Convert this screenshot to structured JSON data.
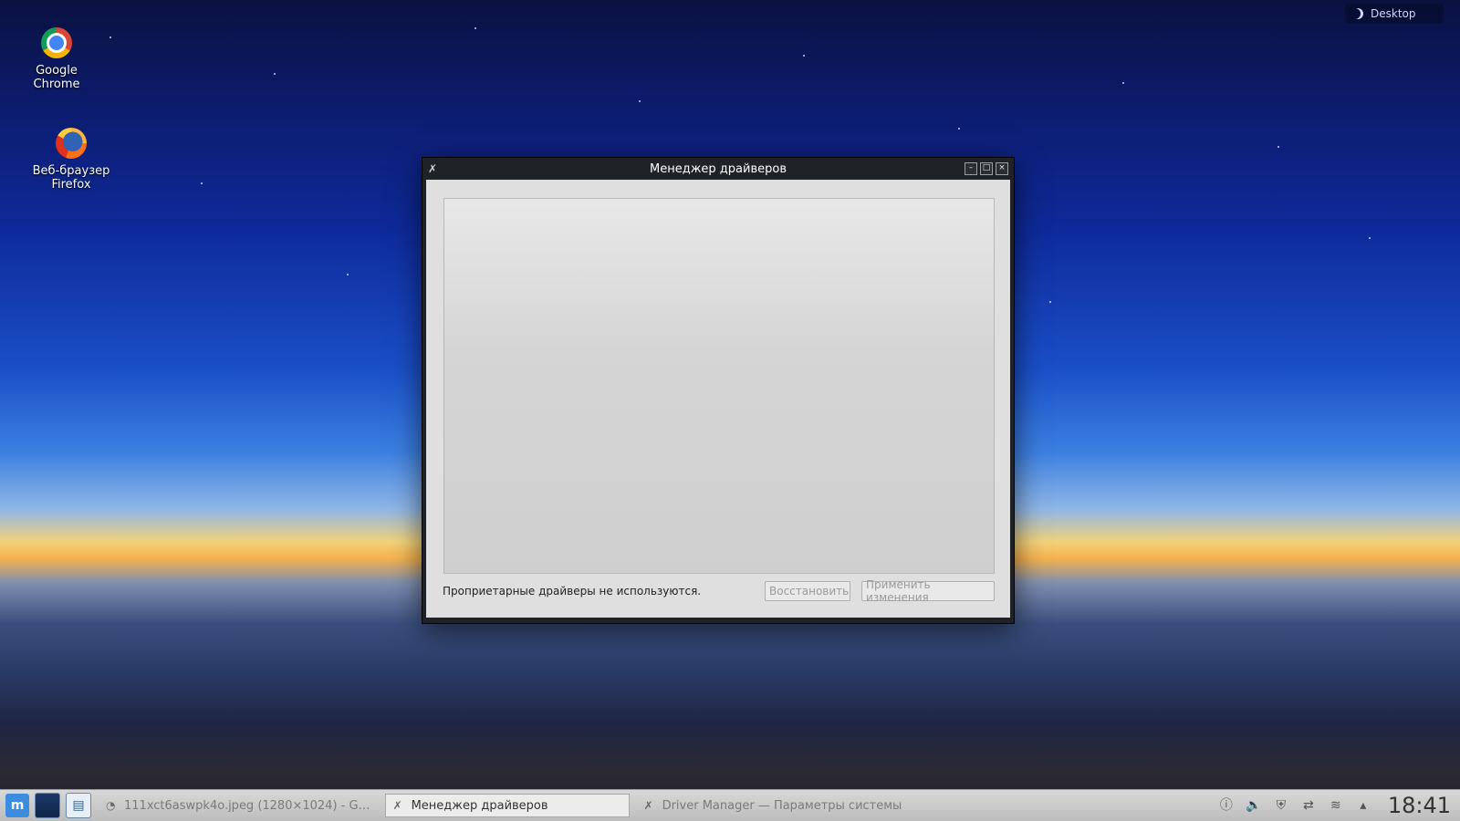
{
  "desktop": {
    "icons": [
      {
        "label_line1": "Google",
        "label_line2": "Chrome"
      },
      {
        "label_line1": "Веб-браузер",
        "label_line2": "Firefox"
      }
    ],
    "widget_label": "Desktop"
  },
  "window": {
    "title": "Менеджер драйверов",
    "status_text": "Проприетарные драйверы не используются.",
    "restore_label": "Восстановить",
    "apply_label": "Применить изменения"
  },
  "taskbar": {
    "tasks": [
      {
        "label": "111xct6aswpk4o.jpeg (1280×1024) - G…"
      },
      {
        "label": "Менеджер драйверов"
      },
      {
        "label": "Driver Manager — Параметры системы"
      }
    ],
    "clock": "18:41"
  }
}
